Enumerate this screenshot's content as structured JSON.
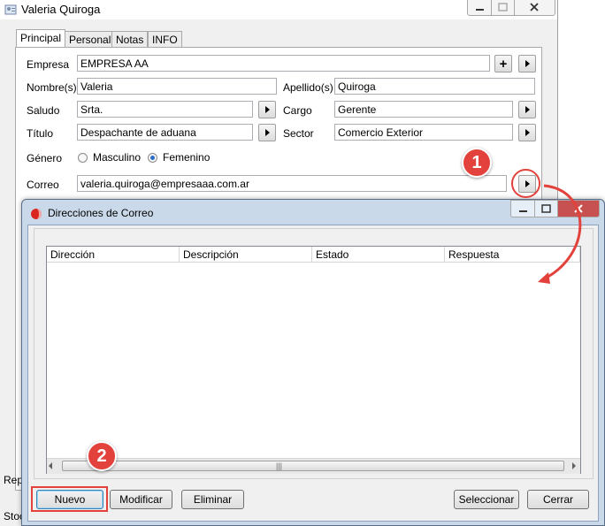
{
  "window": {
    "title": "Valeria Quiroga"
  },
  "tabs": [
    "Principal",
    "Personal",
    "Notas",
    "INFO"
  ],
  "form": {
    "empresa_label": "Empresa",
    "empresa_value": "EMPRESA AA",
    "nombres_label": "Nombre(s)",
    "nombres_value": "Valeria",
    "apellidos_label": "Apellido(s)",
    "apellidos_value": "Quiroga",
    "saludo_label": "Saludo",
    "saludo_value": "Srta.",
    "cargo_label": "Cargo",
    "cargo_value": "Gerente",
    "titulo_label": "Título",
    "titulo_value": "Despachante de aduana",
    "sector_label": "Sector",
    "sector_value": "Comercio Exterior",
    "genero_label": "Género",
    "genero_options": [
      "Masculino",
      "Femenino"
    ],
    "genero_selected": "Femenino",
    "correo_label": "Correo",
    "correo_value": "valeria.quiroga@empresaaa.com.ar"
  },
  "background_fragments": {
    "left_rep": "Rep",
    "left_stock": "Stoc"
  },
  "dialog": {
    "title": "Direcciones de Correo",
    "columns": [
      "Dirección",
      "Descripción",
      "Estado",
      "Respuesta"
    ],
    "buttons": {
      "nuevo": "Nuevo",
      "modificar": "Modificar",
      "eliminar": "Eliminar",
      "seleccionar": "Seleccionar",
      "cerrar": "Cerrar"
    }
  },
  "annotations": {
    "step1": "1",
    "step2": "2"
  },
  "colors": {
    "annotation": "#e2423b",
    "dialog_frame": "#c9d9ea",
    "window_bg": "#f0f0f0"
  }
}
